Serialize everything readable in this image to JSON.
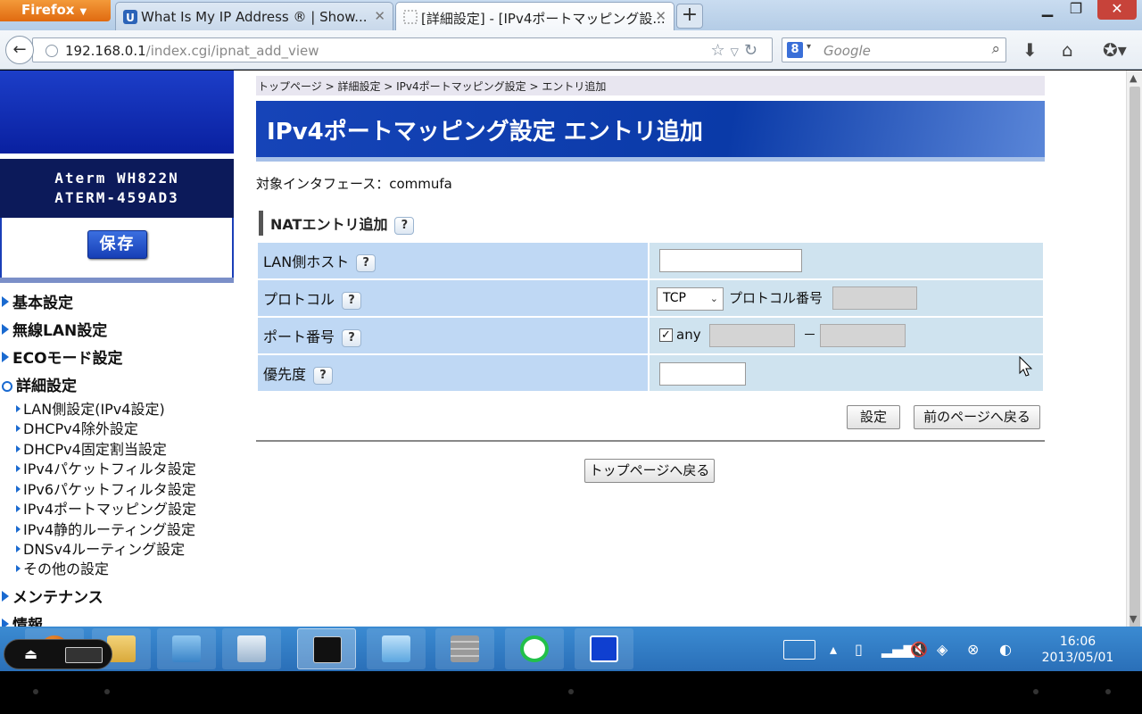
{
  "browser": {
    "menu_label": "Firefox",
    "tabs": [
      {
        "title": "What Is My IP Address ® | Show..."
      },
      {
        "title": "[詳細設定] - [IPv4ポートマッピング設..."
      }
    ],
    "url_host": "192.168.0.1",
    "url_path": "/index.cgi/ipnat_add_view",
    "search_placeholder": "Google"
  },
  "sidebar": {
    "model_line1": "Aterm WH822N",
    "model_line2": "ATERM-459AD3",
    "save_label": "保存",
    "headings": [
      {
        "label": "基本設定"
      },
      {
        "label": "無線LAN設定"
      },
      {
        "label": "ECOモード設定"
      },
      {
        "label": "詳細設定"
      },
      {
        "label": "メンテナンス"
      },
      {
        "label": "情報"
      }
    ],
    "sub_items": [
      {
        "label": "LAN側設定(IPv4設定)"
      },
      {
        "label": "DHCPv4除外設定"
      },
      {
        "label": "DHCPv4固定割当設定"
      },
      {
        "label": "IPv4パケットフィルタ設定"
      },
      {
        "label": "IPv6パケットフィルタ設定"
      },
      {
        "label": "IPv4ポートマッピング設定"
      },
      {
        "label": "IPv4静的ルーティング設定"
      },
      {
        "label": "DNSv4ルーティング設定"
      },
      {
        "label": "その他の設定"
      }
    ]
  },
  "main": {
    "breadcrumb": "トップページ > 詳細設定 > IPv4ポートマッピング設定 > エントリ追加",
    "title": "IPv4ポートマッピング設定 エントリ追加",
    "interface_label": "対象インタフェース：commufa",
    "section_title": "NATエントリ追加",
    "help_glyph": "?",
    "form": {
      "lan_host_label": "LAN側ホスト",
      "lan_host_value": "",
      "protocol_label": "プロトコル",
      "protocol_selected": "TCP",
      "protocol_number_label": "プロトコル番号",
      "protocol_number_value": "",
      "port_label": "ポート番号",
      "port_any_checked": true,
      "port_any_label": "any",
      "port_dash": "－",
      "priority_label": "優先度",
      "priority_value": ""
    },
    "set_button": "設定",
    "back_button": "前のページへ戻る",
    "top_button": "トップページへ戻る"
  },
  "taskbar": {
    "clock_time": "16:06",
    "clock_date": "2013/05/01"
  },
  "colors": {
    "banner_blue": "#0a3aa8",
    "label_cell": "#bfd8f4",
    "value_cell": "#cfe3ef",
    "taskbar": "#2a6fb8"
  }
}
